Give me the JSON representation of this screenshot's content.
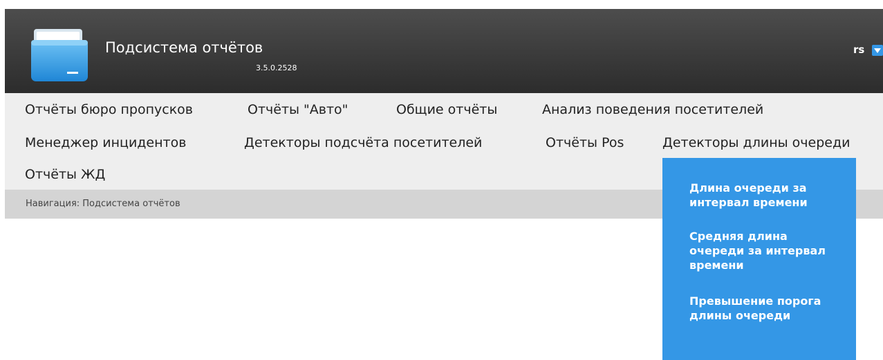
{
  "header": {
    "title": "Подсистема отчётов",
    "version": "3.5.0.2528",
    "user": "rs",
    "colors": {
      "bar": "#3b3b3b",
      "accent": "#3497e6"
    }
  },
  "menu": {
    "items": [
      "Отчёты бюро пропусков",
      "Отчёты \"Авто\"",
      "Общие отчёты",
      "Анализ поведения посетителей",
      "Менеджер инцидентов",
      "Детекторы подсчёта посетителей",
      "Отчёты Pos",
      "Детекторы длины очереди",
      "Отчёты ЖД"
    ]
  },
  "breadcrumb": {
    "text": "Навигация: Подсистема отчётов"
  },
  "dropdown": {
    "items": [
      "Длина очереди за интервал времени",
      "Средняя длина очереди за интервал времени",
      "Превышение порога длины очереди"
    ]
  }
}
